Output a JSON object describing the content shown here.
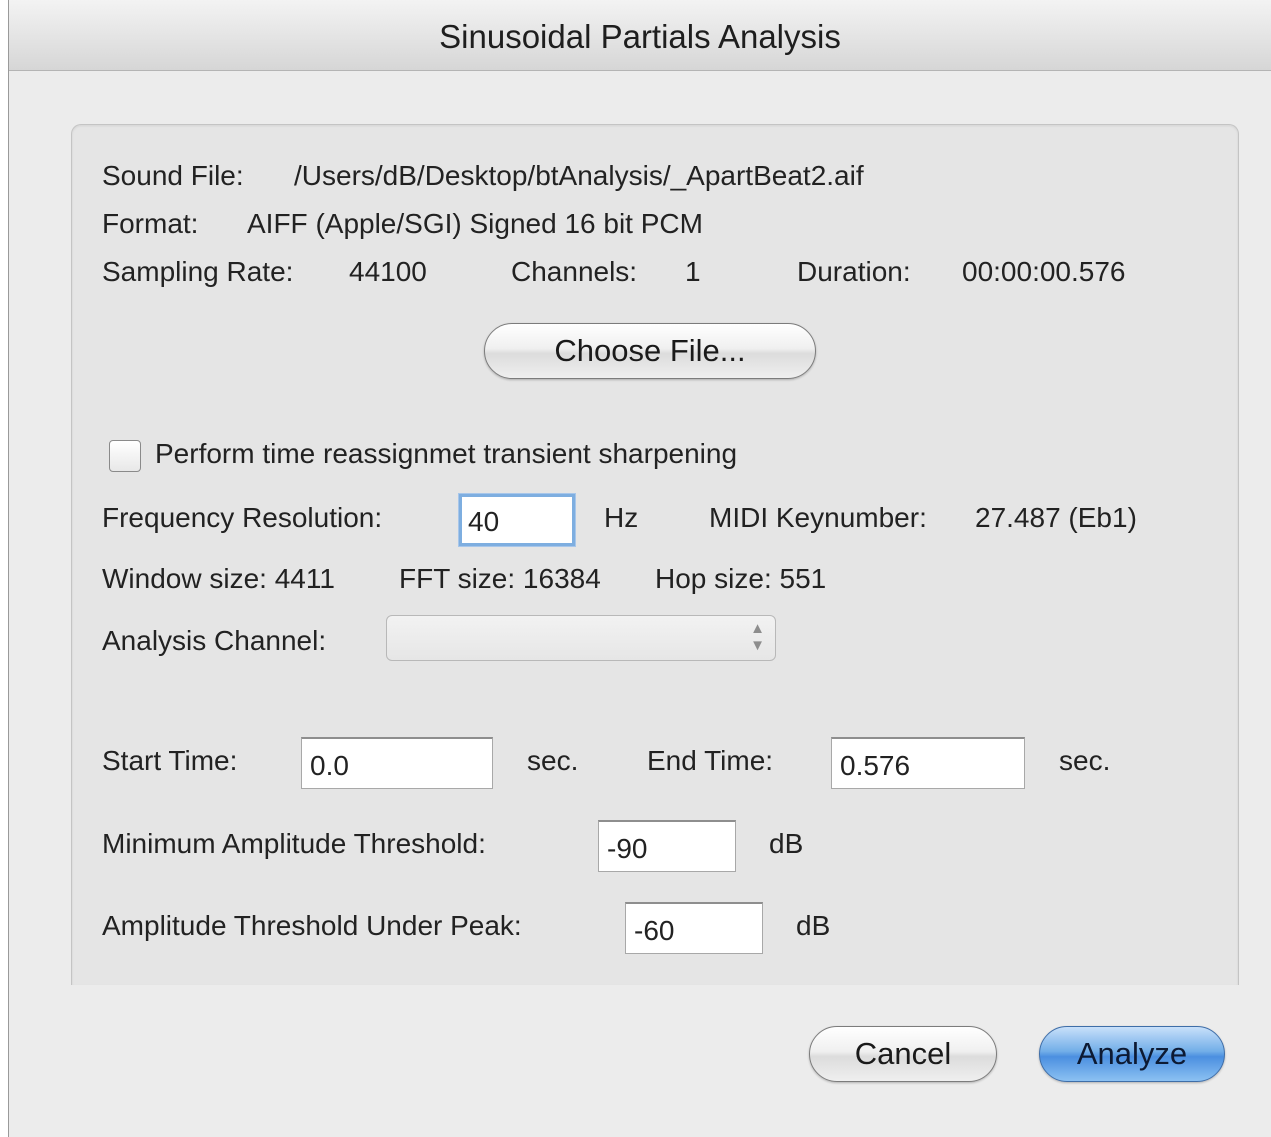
{
  "window": {
    "title": "Sinusoidal Partials Analysis"
  },
  "file_info": {
    "sound_file_label": "Sound File:",
    "sound_file_value": "/Users/dB/Desktop/btAnalysis/_ApartBeat2.aif",
    "format_label": "Format:",
    "format_value": "AIFF (Apple/SGI) Signed 16 bit PCM",
    "sampling_rate_label": "Sampling Rate:",
    "sampling_rate_value": "44100",
    "channels_label": "Channels:",
    "channels_value": "1",
    "duration_label": "Duration:",
    "duration_value": "00:00:00.576",
    "choose_file_label": "Choose File..."
  },
  "options": {
    "transient_sharpening_label": "Perform time reassignmet transient sharpening",
    "transient_sharpening_checked": false,
    "freq_res_label": "Frequency Resolution:",
    "freq_res_value": "40",
    "freq_res_unit": "Hz",
    "midi_label": "MIDI Keynumber:",
    "midi_value": "27.487 (Eb1)",
    "window_size_text": "Window size: 4411",
    "fft_size_text": "FFT size: 16384",
    "hop_size_text": "Hop size: 551",
    "analysis_channel_label": "Analysis Channel:",
    "analysis_channel_value": ""
  },
  "range": {
    "start_label": "Start Time:",
    "start_value": "0.0",
    "start_unit": "sec.",
    "end_label": "End Time:",
    "end_value": "0.576",
    "end_unit": "sec."
  },
  "thresholds": {
    "min_amp_label": "Minimum Amplitude Threshold:",
    "min_amp_value": "-90",
    "min_amp_unit": "dB",
    "under_peak_label": "Amplitude Threshold Under Peak:",
    "under_peak_value": "-60",
    "under_peak_unit": "dB"
  },
  "buttons": {
    "cancel": "Cancel",
    "analyze": "Analyze"
  }
}
